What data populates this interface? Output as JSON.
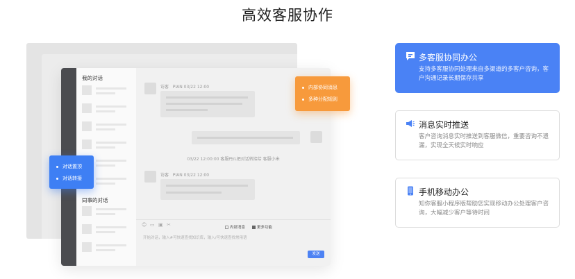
{
  "page": {
    "title": "高效客服协作"
  },
  "conversation_list": {
    "my_heading": "我的对话",
    "colleague_heading": "同事的对话"
  },
  "chat": {
    "incoming_1": {
      "sender": "访客",
      "meta": "PIAN 03/22 12:00"
    },
    "system_notice": "03/22 12:00:00 客服丹/L把对话转接给 客服小米",
    "incoming_2": {
      "sender": "访客",
      "meta": "PIAN 03/22 12:00"
    },
    "toolbar": {
      "internal_msg_label": "内部消息",
      "more_label": "更多功能"
    },
    "input_placeholder": "开始对话，输入#可快速查找知识库，输入/可快速查找常用语",
    "send_label": "发送"
  },
  "popups": {
    "orange": [
      "内部协同消息",
      "多种分配规则"
    ],
    "blue": [
      "对话置顶",
      "对话转接"
    ]
  },
  "features": [
    {
      "icon": "chat-bubble-icon",
      "title": "多客服协同办公",
      "desc": "支持多客服协同处理来自多渠道的多客户咨询，客户沟通记录长期保存共享",
      "active": true
    },
    {
      "icon": "megaphone-icon",
      "title": "消息实时推送",
      "desc": "客户咨询消息实时推送到客服微信，重要咨询不遗漏，实现全天候实时响应",
      "active": false
    },
    {
      "icon": "mobile-phone-icon",
      "title": "手机移动办公",
      "desc": "知你客服小程序版帮助您实现移动办公处理客户咨询，大幅减少客户等待时间",
      "active": false
    }
  ],
  "colors": {
    "accent_blue": "#4a82f5",
    "popup_orange": "#f79a3c",
    "rail_dark": "#4b4c50"
  }
}
